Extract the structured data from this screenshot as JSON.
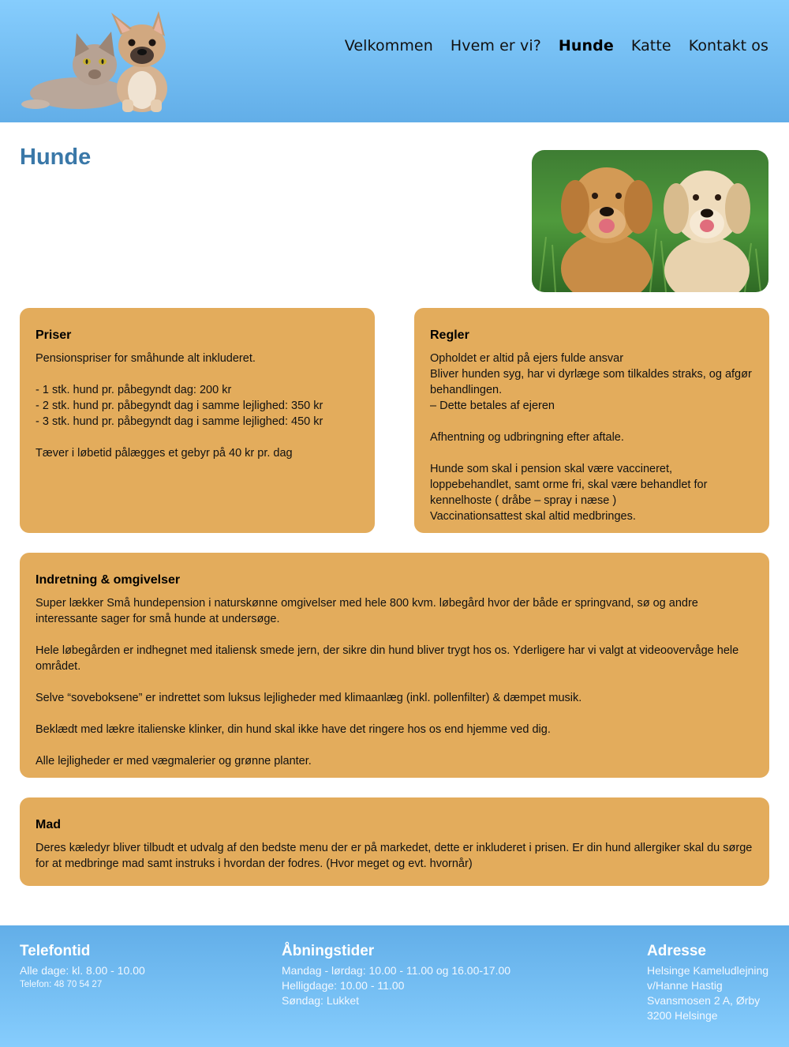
{
  "nav": {
    "items": [
      {
        "label": "Velkommen",
        "active": false
      },
      {
        "label": "Hvem er vi?",
        "active": false
      },
      {
        "label": "Hunde",
        "active": true
      },
      {
        "label": "Katte",
        "active": false
      },
      {
        "label": "Kontakt os",
        "active": false
      }
    ]
  },
  "page": {
    "title": "Hunde"
  },
  "cards": {
    "priser": {
      "title": "Priser",
      "body": "Pensionspriser for småhunde alt inkluderet.\n\n  - 1 stk. hund pr. påbegyndt dag: 200 kr\n  - 2 stk. hund pr. påbegyndt dag i samme lejlighed: 350 kr\n  - 3 stk. hund pr. påbegyndt dag i samme lejlighed: 450 kr\n\nTæver i løbetid pålægges et gebyr på 40 kr pr. dag"
    },
    "regler": {
      "title": "Regler",
      "body": "Opholdet er altid på ejers fulde ansvar\nBliver hunden syg, har vi dyrlæge som tilkaldes straks, og afgør behandlingen.\n– Dette betales af ejeren\n\nAfhentning og udbringning efter aftale.\n\nHunde som skal i pension skal være vaccineret, loppebehandlet, samt orme fri, skal være behandlet for kennelhoste ( dråbe – spray i næse )\nVaccinationsattest skal altid medbringes."
    },
    "indretning": {
      "title": "Indretning & omgivelser",
      "body": "Super lækker Små hundepension i naturskønne omgivelser med hele 800 kvm. løbegård hvor der både er springvand, sø og andre interessante sager for små hunde at undersøge.\n\nHele løbegården er indhegnet med italiensk smede jern, der sikre din hund bliver trygt hos os. Yderligere har vi valgt at videoovervåge hele området.\n\nSelve “soveboksene” er indrettet som luksus lejligheder med klimaanlæg (inkl. pollenfilter) & dæmpet musik.\n\nBeklædt med lækre italienske klinker, din hund skal ikke have det ringere hos os end hjemme ved dig.\n\nAlle lejligheder er med vægmalerier og grønne planter."
    },
    "mad": {
      "title": "Mad",
      "body": "Deres kæledyr bliver tilbudt et udvalg af den bedste menu der er på markedet, dette er inkluderet i prisen. Er din hund allergiker skal du sørge for at medbringe mad samt instruks i hvordan der fodres. (Hvor meget og evt. hvornår)"
    }
  },
  "footer": {
    "telefontid": {
      "title": "Telefontid",
      "line1": "Alle dage: kl. 8.00 - 10.00",
      "phone": "Telefon: 48 70 54 27"
    },
    "abningstider": {
      "title": "Åbningstider",
      "line1": "Mandag - lørdag: 10.00 - 11.00 og 16.00-17.00",
      "line2": "Helligdage: 10.00 - 11.00",
      "line3": "Søndag: Lukket"
    },
    "adresse": {
      "title": "Adresse",
      "line1": "Helsinge Kameludlejning",
      "line2": "v/Hanne Hastig",
      "line3": "Svansmosen 2 A, Ørby",
      "line4": "3200 Helsinge"
    }
  },
  "colors": {
    "header_top": "#86cdfd",
    "header_bottom": "#62aee8",
    "card_bg": "#e3ac5c",
    "title_blue": "#3a78a8"
  }
}
